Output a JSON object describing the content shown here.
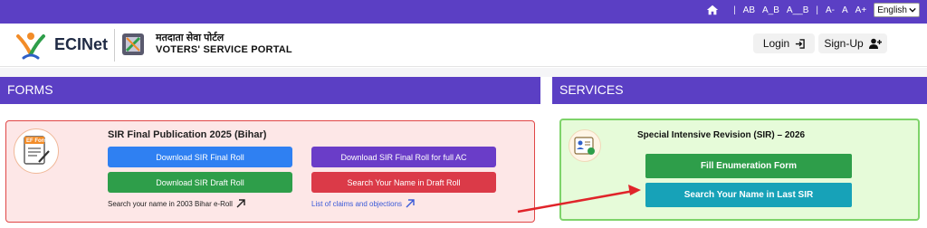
{
  "topbar": {
    "home_icon": "home-icon",
    "text_ab": "AB",
    "text_a_b": "A_B",
    "text_a__b": "A__B",
    "text_a_minus": "A-",
    "text_a": "A",
    "text_a_plus": "A+",
    "language": "English",
    "color": "#5b3fc4"
  },
  "header": {
    "brand": "ECINet",
    "portal_hindi": "मतदाता सेवा पोर्टल",
    "portal_english": "VOTERS' SERVICE PORTAL",
    "login_label": "Login",
    "signup_label": "Sign-Up"
  },
  "forms": {
    "heading": "FORMS",
    "card_icon_label": "EF Form",
    "title": "SIR Final Publication 2025 (Bihar)",
    "buttons": [
      {
        "label": "Download SIR Final Roll",
        "color": "#2f80f2"
      },
      {
        "label": "Download SIR Final Roll for full AC",
        "color": "#6a3dc8"
      },
      {
        "label": "Download SIR Draft Roll",
        "color": "#2e9e4a"
      },
      {
        "label": "Search Your Name in Draft Roll",
        "color": "#db3a48"
      }
    ],
    "link_1": "Search your name in 2003 Bihar e-Roll",
    "link_2": "List of claims and objections"
  },
  "services": {
    "heading": "SERVICES",
    "title": "Special Intensive Revision (SIR) – 2026",
    "button_1": "Fill Enumeration Form",
    "button_2": "Search Your Name in Last SIR",
    "button_1_color": "#2e9e4a",
    "button_2_color": "#17a2b8"
  },
  "annotation": {
    "arrow_color": "#e0242a"
  }
}
